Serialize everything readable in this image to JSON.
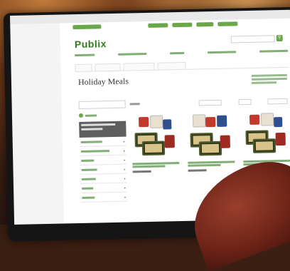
{
  "browser": {
    "title": ""
  },
  "site": {
    "logo": "Publix",
    "page_title": "Holiday Meals"
  }
}
